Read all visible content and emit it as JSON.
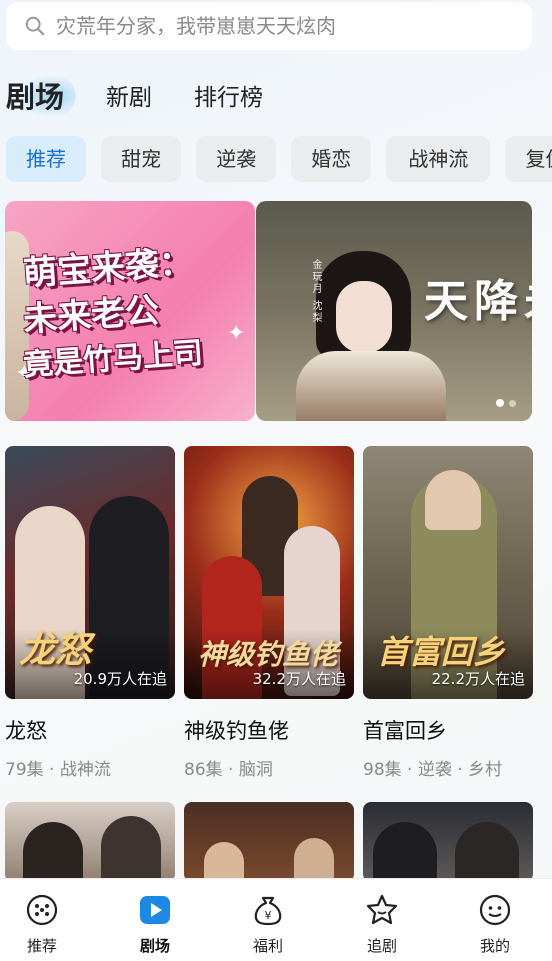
{
  "search": {
    "placeholder": "灾荒年分家，我带崽崽天天炫肉"
  },
  "top_tabs": [
    {
      "label": "剧场",
      "active": true
    },
    {
      "label": "新剧",
      "active": false
    },
    {
      "label": "排行榜",
      "active": false
    }
  ],
  "chips": [
    {
      "label": "推荐",
      "active": true
    },
    {
      "label": "甜宠",
      "active": false
    },
    {
      "label": "逆袭",
      "active": false
    },
    {
      "label": "婚恋",
      "active": false
    },
    {
      "label": "战神流",
      "active": false
    },
    {
      "label": "复仇",
      "active": false
    }
  ],
  "banners": [
    {
      "title_lines": [
        "萌宝来袭：",
        "未来老公",
        "竟是竹马上司"
      ]
    },
    {
      "title": "天降未",
      "tagline": "金玩月 沈梨"
    }
  ],
  "carousel": {
    "dot_count": 2,
    "active_index": 0
  },
  "dramas": [
    {
      "poster_title": "龙怒",
      "watchers": "20.9万人在追",
      "name": "龙怒",
      "meta": "79集 · 战神流"
    },
    {
      "poster_title": "神级钓鱼佬",
      "watchers": "32.2万人在追",
      "name": "神级钓鱼佬",
      "meta": "86集 · 脑洞"
    },
    {
      "poster_title": "首富回乡",
      "watchers": "22.2万人在追",
      "name": "首富回乡",
      "meta": "98集 · 逆袭 · 乡村"
    }
  ],
  "bottom_nav": [
    {
      "label": "推荐",
      "icon": "dice-icon",
      "active": false
    },
    {
      "label": "剧场",
      "icon": "play-icon",
      "active": true
    },
    {
      "label": "福利",
      "icon": "money-bag-icon",
      "active": false
    },
    {
      "label": "追剧",
      "icon": "star-icon",
      "active": false
    },
    {
      "label": "我的",
      "icon": "smile-icon",
      "active": false
    }
  ],
  "colors": {
    "accent": "#1a6fd0",
    "chip_active_bg": "#d9ecfb",
    "chip_bg": "#ebeced",
    "meta_text": "#8a8a8a"
  }
}
